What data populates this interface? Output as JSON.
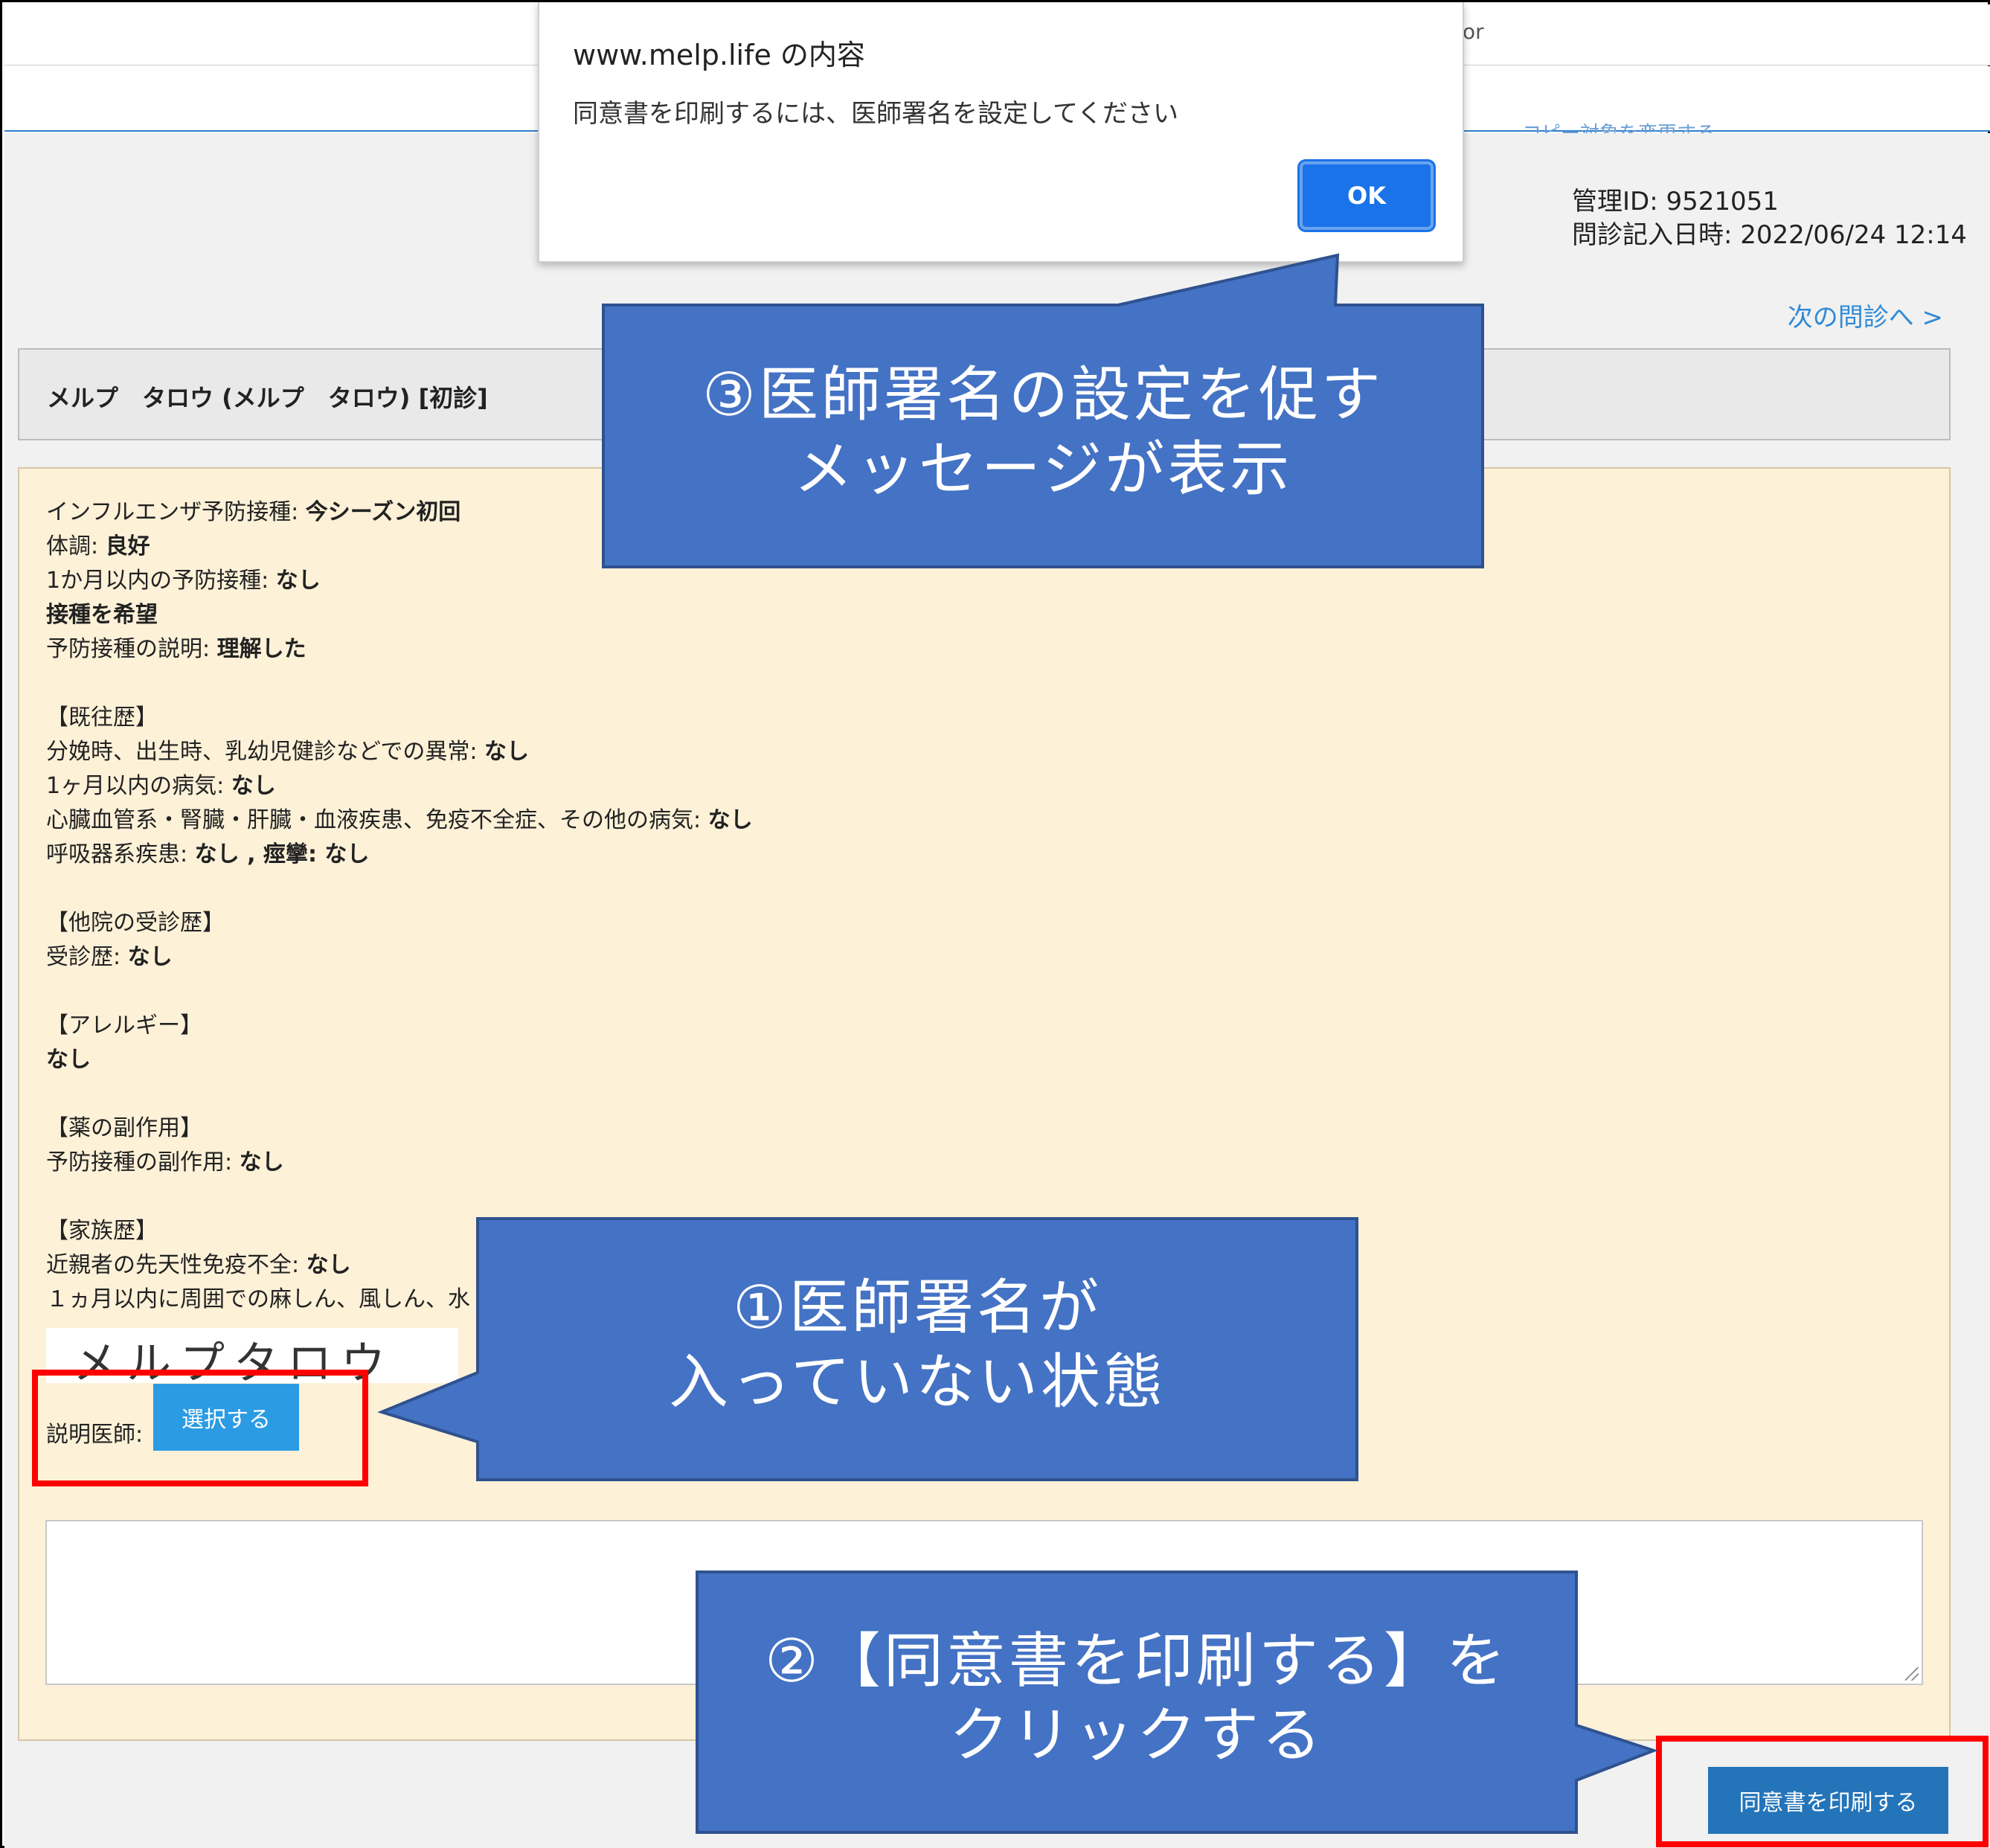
{
  "topbar": {
    "cut_text_1": "or",
    "cut_text_2": "コピー対象を変更する"
  },
  "meta": {
    "manage_id": "管理ID: 9521051",
    "entry_datetime": "問診記入日時: 2022/06/24 12:14"
  },
  "next_link": "次の問診へ >",
  "patient": {
    "name": "メルプ　タロウ (メルプ　タロウ) [初診]"
  },
  "questionnaire": [
    {
      "label": "インフルエンザ予防接種: ",
      "value": "今シーズン初回"
    },
    {
      "label": "体調: ",
      "value": "良好"
    },
    {
      "label": "1か月以内の予防接種: ",
      "value": "なし"
    },
    {
      "label": "",
      "value": "接種を希望"
    },
    {
      "label": "予防接種の説明: ",
      "value": "理解した"
    },
    {
      "label": "",
      "value": ""
    },
    {
      "label": "【既往歴】",
      "value": ""
    },
    {
      "label": "分娩時、出生時、乳幼児健診などでの異常: ",
      "value": "なし"
    },
    {
      "label": "1ヶ月以内の病気: ",
      "value": "なし"
    },
    {
      "label": "心臓血管系・腎臓・肝臓・血液疾患、免疫不全症、その他の病気: ",
      "value": "なし"
    },
    {
      "label": "呼吸器系疾患: ",
      "value": "なし , 痙攣: なし"
    },
    {
      "label": "",
      "value": ""
    },
    {
      "label": "【他院の受診歴】",
      "value": ""
    },
    {
      "label": "受診歴: ",
      "value": "なし"
    },
    {
      "label": "",
      "value": ""
    },
    {
      "label": "【アレルギー】",
      "value": ""
    },
    {
      "label": "",
      "value": "なし"
    },
    {
      "label": "",
      "value": ""
    },
    {
      "label": "【薬の副作用】",
      "value": ""
    },
    {
      "label": "予防接種の副作用: ",
      "value": "なし"
    },
    {
      "label": "",
      "value": ""
    },
    {
      "label": "【家族歴】",
      "value": ""
    },
    {
      "label": "近親者の先天性免疫不全: ",
      "value": "なし"
    },
    {
      "label": "１ヵ月以内に周囲での麻しん、風しん、水",
      "value": ""
    }
  ],
  "signature": {
    "text": "メルプタロウ"
  },
  "doctor": {
    "label": "説明医師:",
    "select_button": "選択する"
  },
  "notes": {
    "value": ""
  },
  "print_button": "同意書を印刷する",
  "dialog": {
    "title": "www.melp.life の内容",
    "message": "同意書を印刷するには、医師署名を設定してください",
    "ok": "OK"
  },
  "callouts": {
    "c1_line1": "①医師署名が",
    "c1_line2": "入っていない状態",
    "c2_line1": "②【同意書を印刷する】を",
    "c2_line2": "クリックする",
    "c3_line1": "③医師署名の設定を促す",
    "c3_line2": "メッセージが表示"
  },
  "colors": {
    "callout_fill": "#4472c4",
    "callout_border": "#2f528f",
    "highlight": "#ff0000",
    "panel": "#fdf1d8",
    "print_button": "#2474b9",
    "select_button": "#2b9be4"
  }
}
